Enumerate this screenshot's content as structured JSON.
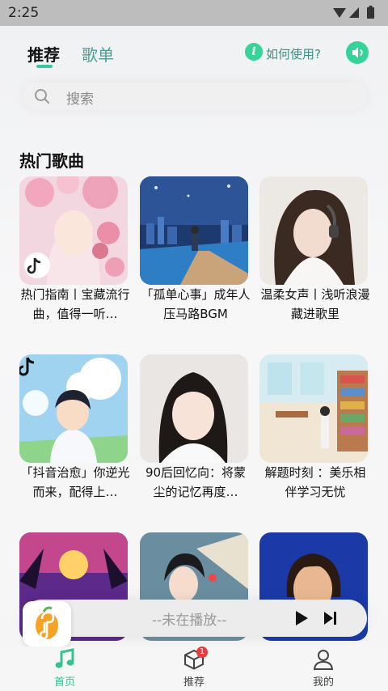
{
  "status_bar": {
    "time": "2:25"
  },
  "header": {
    "tabs": [
      {
        "label": "推荐",
        "active": true
      },
      {
        "label": "歌单",
        "active": false
      }
    ],
    "help_label": "如何使用?"
  },
  "search": {
    "placeholder": "搜索"
  },
  "section_title": "热门歌曲",
  "songs": [
    {
      "title": "热门指南丨宝藏流行曲，值得一听…"
    },
    {
      "title": "「孤单心事」成年人压马路BGM"
    },
    {
      "title": "温柔女声丨浅听浪漫藏进歌里"
    },
    {
      "title": "「抖音治愈」你逆光而来，配得上…"
    },
    {
      "title": "90后回忆向：将蒙尘的记忆再度…"
    },
    {
      "title": "解题时刻 ：美乐相伴学习无忧"
    },
    {
      "title": ""
    },
    {
      "title": ""
    },
    {
      "title": ""
    }
  ],
  "player": {
    "status": "--未在播放--"
  },
  "bottom_nav": [
    {
      "label": "首页",
      "active": true
    },
    {
      "label": "推荐",
      "badge": "1"
    },
    {
      "label": "我的"
    }
  ],
  "colors": {
    "accent": "#35c194",
    "tab_inactive": "#4a9f94"
  }
}
